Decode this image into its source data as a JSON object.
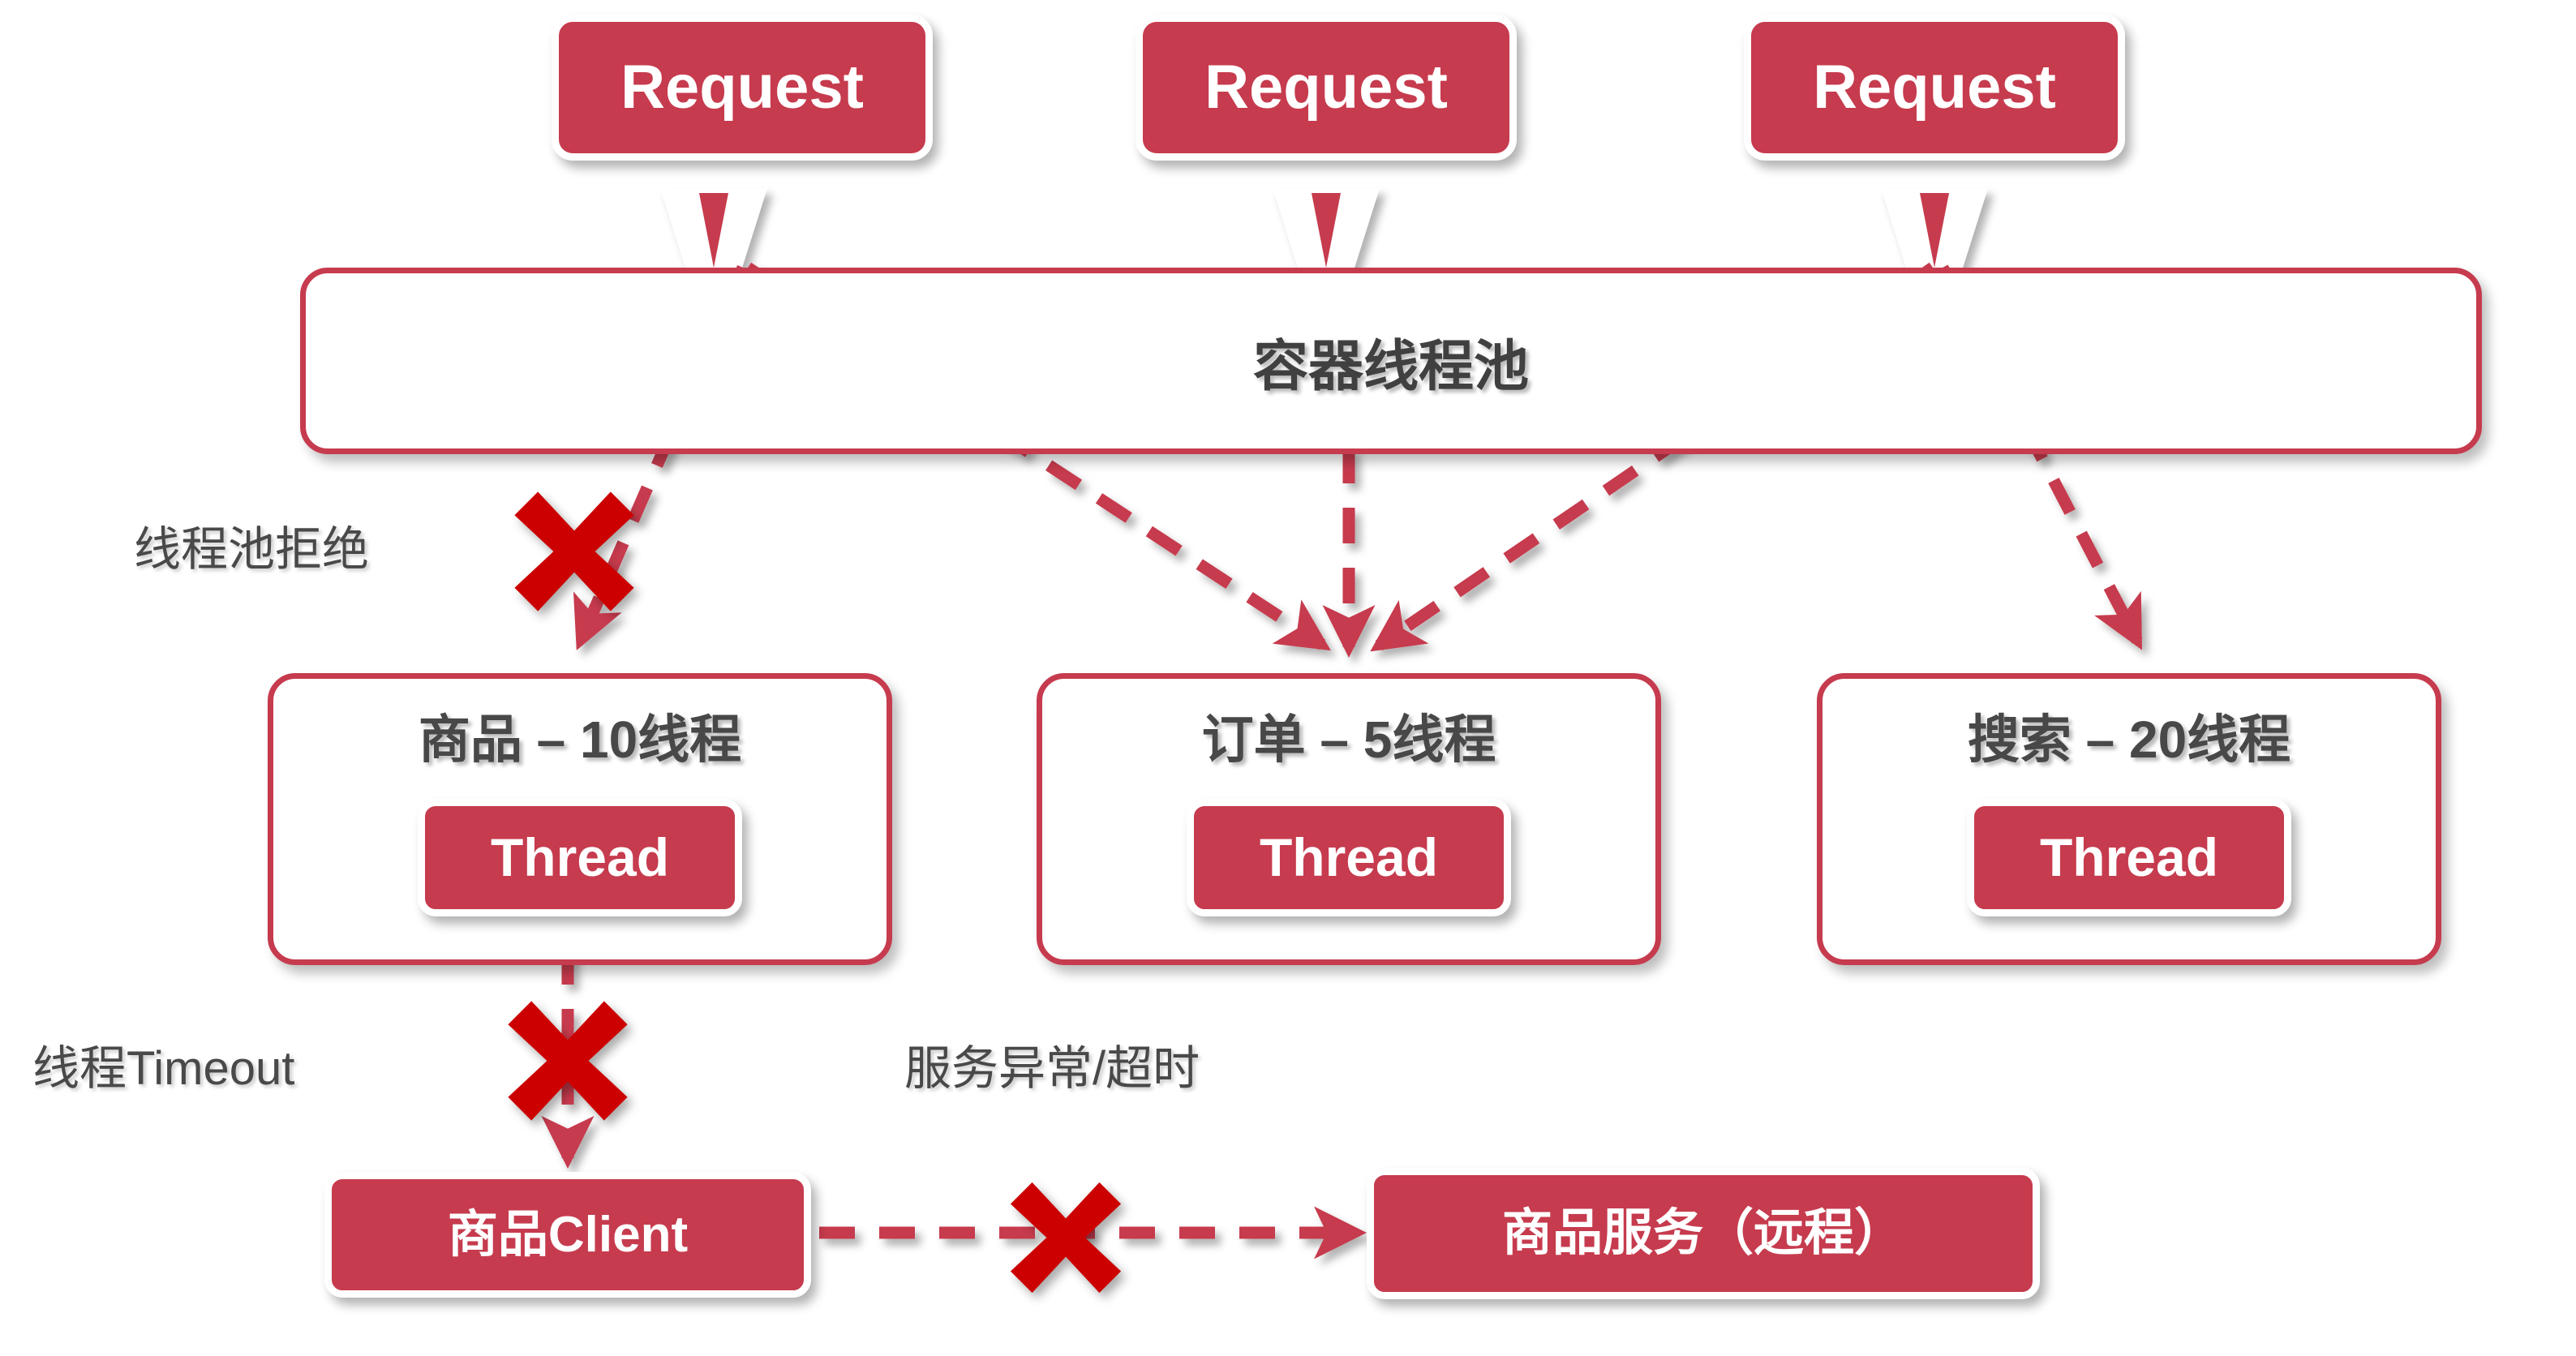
{
  "theme": {
    "pill_fill": "#C63B4E",
    "border_red": "#C63B4E",
    "x_red": "#CC0000",
    "text_grey": "#484848",
    "background": "#FFFFFF"
  },
  "requests": [
    {
      "label": "Request"
    },
    {
      "label": "Request"
    },
    {
      "label": "Request"
    }
  ],
  "pool": {
    "title": "容器线程池"
  },
  "services": [
    {
      "title": "商品 – 10线程",
      "thread_label": "Thread"
    },
    {
      "title": "订单 – 5线程",
      "thread_label": "Thread"
    },
    {
      "title": "搜索 – 20线程",
      "thread_label": "Thread"
    }
  ],
  "notes": {
    "reject": "线程池拒绝",
    "timeout": "线程Timeout",
    "service_error": "服务异常/超时"
  },
  "bottom": {
    "client_label": "商品Client",
    "service_label": "商品服务（远程）"
  },
  "icons": {
    "x_reject": "x-mark-icon",
    "x_timeout": "x-mark-icon",
    "x_service_error": "x-mark-icon"
  }
}
